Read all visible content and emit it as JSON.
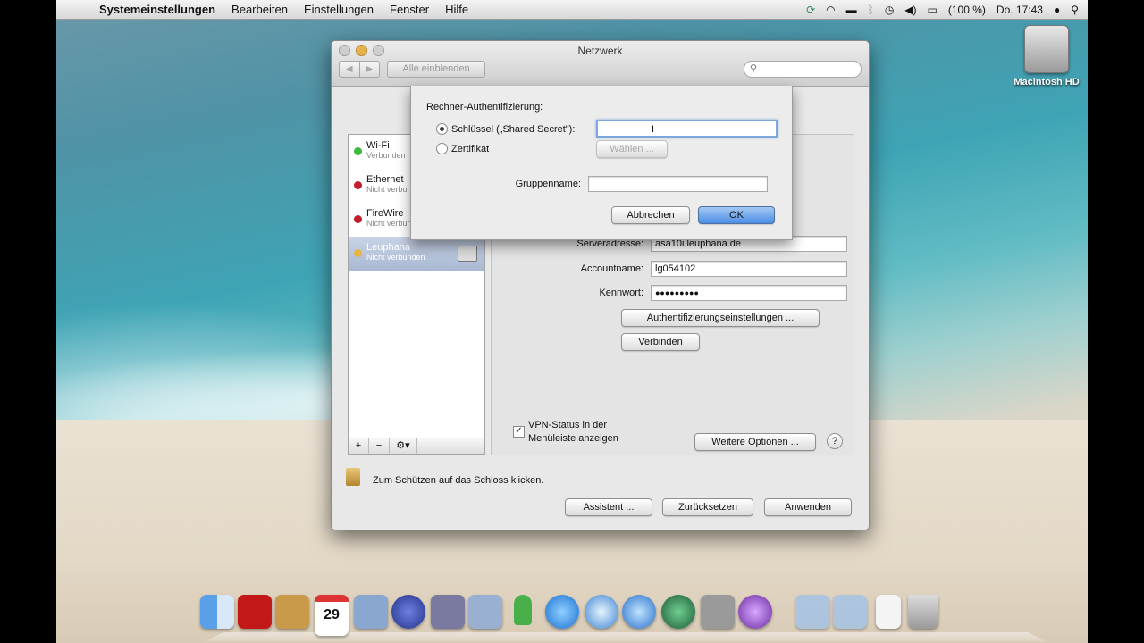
{
  "menubar": {
    "apple": "",
    "app": "Systemeinstellungen",
    "items": [
      "Bearbeiten",
      "Einstellungen",
      "Fenster",
      "Hilfe"
    ],
    "battery": "(100 %)",
    "clock": "Do. 17:43"
  },
  "desktop": {
    "hd_label": "Macintosh HD"
  },
  "window": {
    "title": "Netzwerk",
    "show_all": "Alle einblenden",
    "search_placeholder": ""
  },
  "services": [
    {
      "name": "Wi-Fi",
      "status": "Verbunden",
      "color": "#3cba3c"
    },
    {
      "name": "Ethernet",
      "status": "Nicht verbunden",
      "color": "#c21c2e"
    },
    {
      "name": "FireWire",
      "status": "Nicht verbunden",
      "color": "#c21c2e"
    },
    {
      "name": "Leuphana",
      "status": "Nicht verbunden",
      "color": "#e8b640"
    }
  ],
  "pane": {
    "server_label": "Serveradresse:",
    "server_value": "asa10i.leuphana.de",
    "account_label": "Accountname:",
    "account_value": "lg054102",
    "password_label": "Kennwort:",
    "password_value": "●●●●●●●●●",
    "auth_button": "Authentifizierungseinstellungen ...",
    "connect_button": "Verbinden",
    "vpn_status": "VPN-Status in der Menüleiste anzeigen",
    "more_options": "Weitere Optionen ...",
    "help": "?"
  },
  "sheet": {
    "heading": "Rechner-Authentifizierung:",
    "shared_secret": "Schlüssel („Shared Secret\"):",
    "certificate": "Zertifikat",
    "choose": "Wählen ...",
    "group_label": "Gruppenname:",
    "cancel": "Abbrechen",
    "ok": "OK"
  },
  "footer": {
    "lock_text": "Zum Schützen auf das Schloss klicken.",
    "assistant": "Assistent ...",
    "reset": "Zurücksetzen",
    "apply": "Anwenden"
  },
  "dock": {
    "calendar_day": "29",
    "apps": [
      "finder-icon",
      "photo-booth-icon",
      "address-book-icon",
      "ical-icon",
      "preview-icon",
      "network-icon",
      "script-editor-icon",
      "tweet-icon",
      "messages-icon",
      "itunes-icon",
      "safari-icon",
      "world-icon",
      "time-machine-icon",
      "system-prefs-icon",
      "podcast-icon",
      "applications-folder-icon",
      "documents-folder-icon",
      "downloads-icon",
      "trash-icon"
    ]
  }
}
